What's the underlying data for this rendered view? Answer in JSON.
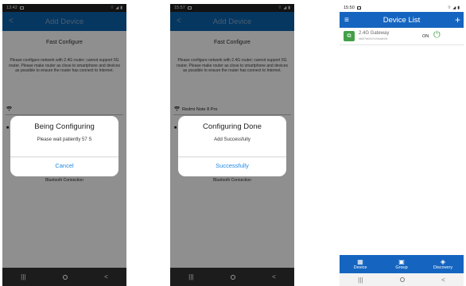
{
  "screen1": {
    "status_time": "13:42",
    "app_title": "Add Device",
    "config_title": "Fast Configure",
    "config_desc": "Please configure network with 2.4G router; cannot support 5G router. Please make router as close to smartphone and devices as possible to ensure the router has connect to Internet.",
    "dialog": {
      "title": "Being Configuring",
      "message": "Please wait patiently 57 S",
      "button": "Cancel"
    },
    "bluetooth_link": "Bluetooth Connection"
  },
  "screen2": {
    "status_time": "15:57",
    "app_title": "Add Device",
    "config_title": "Fast Configure",
    "config_desc": "Please configure network with 2.4G router; cannot support 5G router. Please make router as close to smartphone and devices as possible to ensure the router has connect to Internet.",
    "wifi_name": "Redmi Note 8 Pro",
    "dialog": {
      "title": "Configuring Done",
      "message": "Add Successfully",
      "button": "Successfully"
    },
    "bluetooth_link": "Bluetooth Connection"
  },
  "screen3": {
    "status_time": "15:50",
    "app_title": "Device List",
    "device": {
      "name": "2.4G Gateway",
      "id": "b8d97feb0b7b19fea8b0fe",
      "state": "ON"
    },
    "tabs": [
      {
        "label": "Device",
        "icon": "grid-icon"
      },
      {
        "label": "Group",
        "icon": "group-icon"
      },
      {
        "label": "Discovery",
        "icon": "compass-icon"
      }
    ]
  },
  "colors": {
    "appbar": "#0b5fa5",
    "accent": "#1e88e5",
    "power_on": "#43a047"
  }
}
